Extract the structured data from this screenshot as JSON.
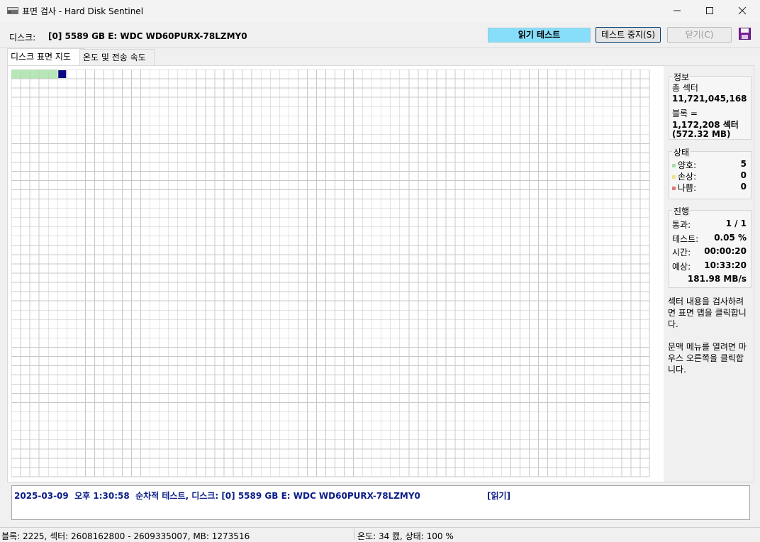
{
  "window": {
    "title": "표면 검사 - Hard Disk Sentinel",
    "minimize": "–",
    "maximize": "☐",
    "close": "✕"
  },
  "header": {
    "disk_label": "디스크:",
    "disk_name": "[0] 5589 GB E: WDC WD60PURX-78LZMY0",
    "test_status": "읽기 테스트",
    "stop_button": "테스트 중지(S)",
    "close_button": "닫기(C)",
    "save_icon": "save-icon"
  },
  "tabs": {
    "surface_map": "디스크 표면 지도",
    "temp_speed": "온도 및 전송 속도"
  },
  "map": {
    "columns": 69,
    "rows": 44,
    "good_blocks": 5,
    "current_block": 5,
    "colors": {
      "grid": "#c8c8c8",
      "good": "#b6e7b6",
      "current": "#0a0a80",
      "empty": "#ffffff"
    }
  },
  "info": {
    "title": "정보",
    "total_sectors_label": "총 섹터",
    "total_sectors": "11,721,045,168",
    "block_label": "블록 =",
    "block_sectors": "1,172,208 섹터",
    "block_mb": "(572.32 MB)"
  },
  "state": {
    "title": "상태",
    "good_label": "양호:",
    "good_value": "5",
    "damaged_label": "손상:",
    "damaged_value": "0",
    "bad_label": "나쁨:",
    "bad_value": "0",
    "colors": {
      "good": "#a8e0a8",
      "damaged": "#f2e08a",
      "bad": "#e07a7a"
    }
  },
  "progress": {
    "title": "진행",
    "pass_label": "통과:",
    "pass_value": "1 / 1",
    "test_label": "테스트:",
    "test_value": "0.05 %",
    "time_label": "시간:",
    "time_value": "00:00:20",
    "eta_label": "예상:",
    "eta_value": "10:33:20",
    "speed": "181.98 MB/s"
  },
  "notes": {
    "note1_line1": "섹터 내용을 검사하려",
    "note1_line2": "면 표면 맵을 클릭합니",
    "note1_line3": "다.",
    "note2_line1": "문맥 메뉴를 열려면 마",
    "note2_line2": "우스 오른쪽을 클릭합",
    "note2_line3": "니다."
  },
  "log": {
    "entry": "2025-03-09  오후 1:30:58  순차적 테스트, 디스크: [0] 5589 GB E: WDC WD60PURX-78LZMY0",
    "tag": "[읽기]"
  },
  "statusbar": {
    "block_info": "블록: 2225, 섹터: 2608162800 - 2609335007, MB: 1273516",
    "temp_status": "온도: 34  캜,  상태: 100 %"
  }
}
